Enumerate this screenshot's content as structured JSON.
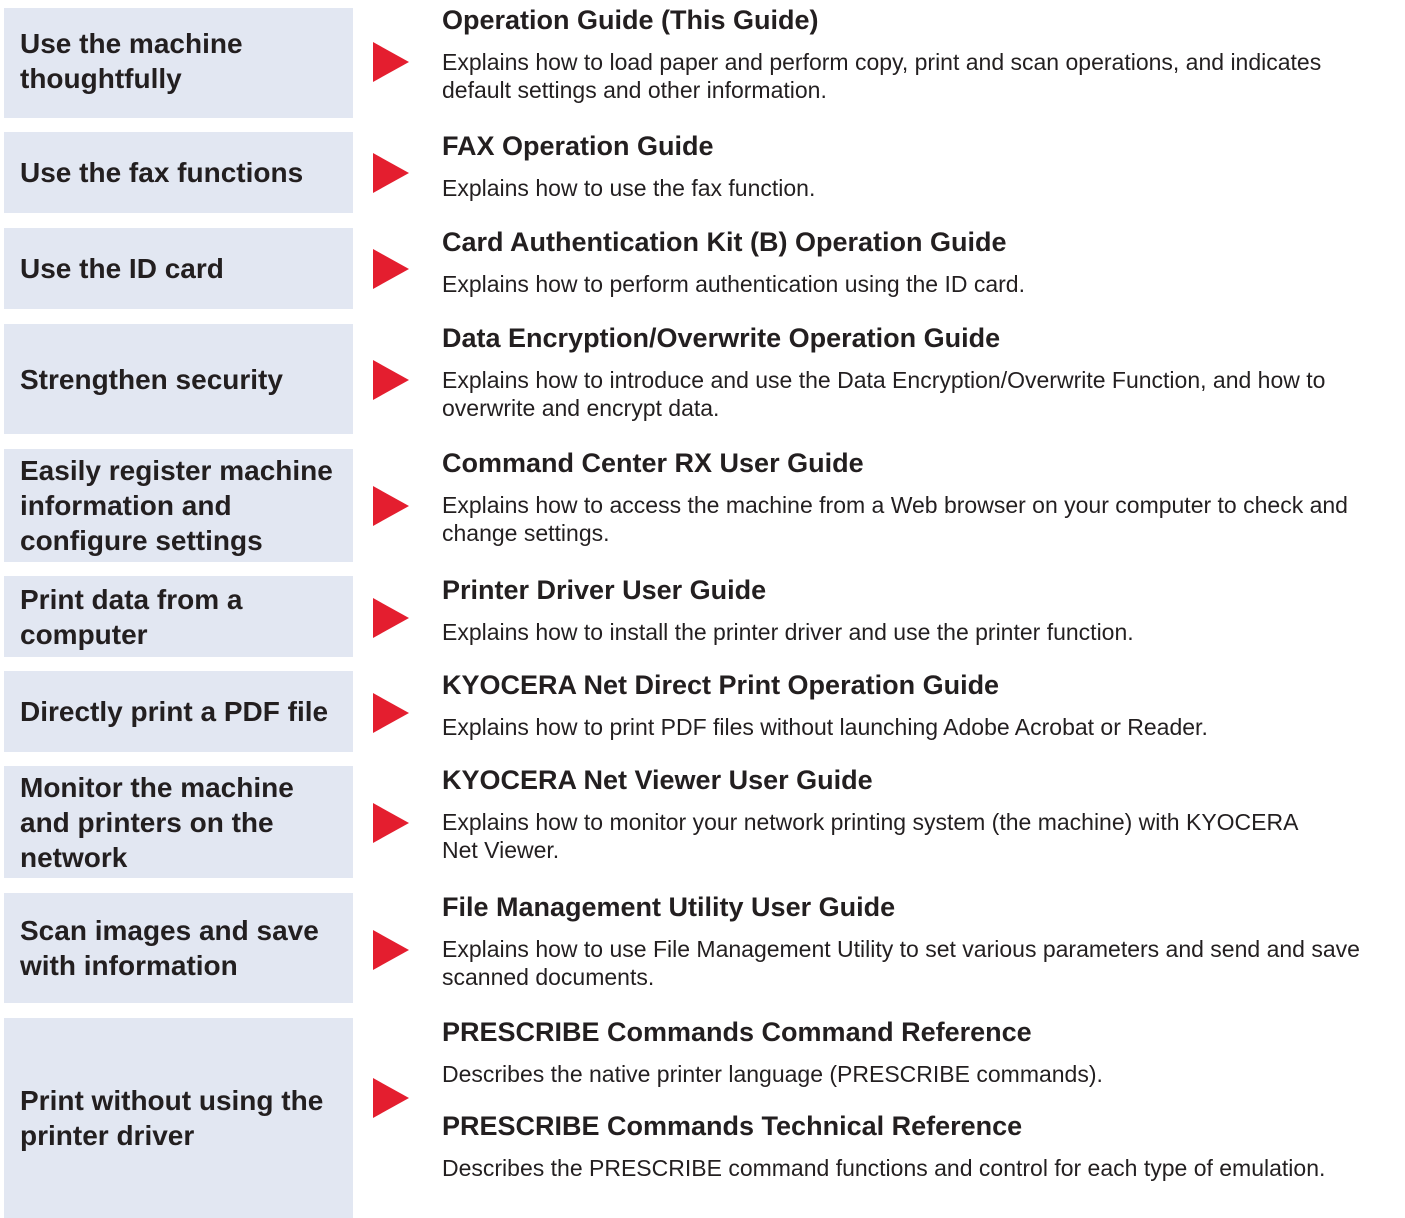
{
  "accent_color": "#e41e2f",
  "task_background": "#e2e7f2",
  "arrow_icon": "red-triangle-arrow",
  "rows": [
    {
      "task": "Use the machine thoughtfully",
      "guides": [
        {
          "title": "Operation Guide (This Guide)",
          "description": "Explains how to load paper and perform copy, print and scan operations, and indicates default settings and other information."
        }
      ]
    },
    {
      "task": "Use the fax functions",
      "guides": [
        {
          "title": "FAX Operation Guide",
          "description": "Explains how to use the fax function."
        }
      ]
    },
    {
      "task": "Use the ID card",
      "guides": [
        {
          "title": "Card Authentication Kit (B) Operation Guide",
          "description": "Explains how to perform authentication using the ID card."
        }
      ]
    },
    {
      "task": "Strengthen security",
      "guides": [
        {
          "title": "Data Encryption/Overwrite Operation Guide",
          "description": "Explains how to introduce and use the Data Encryption/Overwrite Function, and how to overwrite and encrypt data."
        }
      ]
    },
    {
      "task": "Easily register machine information and configure settings",
      "guides": [
        {
          "title": "Command Center RX User Guide",
          "description": "Explains how to access the machine from a Web browser on your computer to check and change settings."
        }
      ]
    },
    {
      "task": "Print data from a computer",
      "guides": [
        {
          "title": "Printer Driver User Guide",
          "description": "Explains how to install the printer driver and use the printer function."
        }
      ]
    },
    {
      "task": "Directly print a PDF file",
      "guides": [
        {
          "title": "KYOCERA Net Direct Print Operation Guide",
          "description": "Explains how to print PDF files without launching Adobe Acrobat or Reader."
        }
      ]
    },
    {
      "task": "Monitor the machine and printers on the network",
      "guides": [
        {
          "title": "KYOCERA Net Viewer User Guide",
          "description": "Explains how to monitor your network printing system (the machine) with KYOCERA Net Viewer."
        }
      ]
    },
    {
      "task": "Scan images and save with information",
      "guides": [
        {
          "title": "File Management Utility User Guide",
          "description": "Explains how to use File Management Utility to set various parameters and send and save scanned documents."
        }
      ]
    },
    {
      "task": "Print without using the printer driver",
      "guides": [
        {
          "title": "PRESCRIBE Commands Command Reference",
          "description": "Describes the native printer language (PRESCRIBE commands)."
        },
        {
          "title": "PRESCRIBE Commands Technical Reference",
          "description": "Describes the PRESCRIBE command functions and control for each type of emulation."
        }
      ]
    }
  ]
}
